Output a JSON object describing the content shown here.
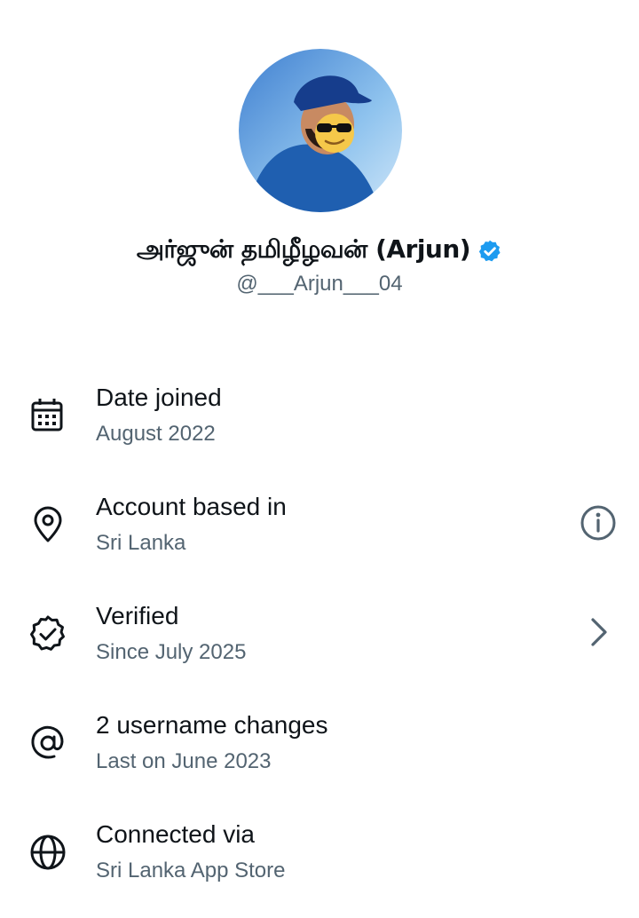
{
  "profile": {
    "display_name": "அர்ஜுன் தமிழீழவன் (Arjun)",
    "handle": "@___Arjun___04",
    "verified_color": "#1d9bf0"
  },
  "details": [
    {
      "icon": "calendar-icon",
      "label": "Date joined",
      "value": "August 2022"
    },
    {
      "icon": "location-pin-icon",
      "label": "Account based in",
      "value": "Sri Lanka",
      "action_icon": "info-icon"
    },
    {
      "icon": "verified-badge-outline-icon",
      "label": "Verified",
      "value": "Since July 2025",
      "action_icon": "chevron-right-icon"
    },
    {
      "icon": "at-sign-icon",
      "label": "2 username changes",
      "value": "Last on June 2023"
    },
    {
      "icon": "globe-icon",
      "label": "Connected via",
      "value": "Sri Lanka App Store"
    }
  ]
}
